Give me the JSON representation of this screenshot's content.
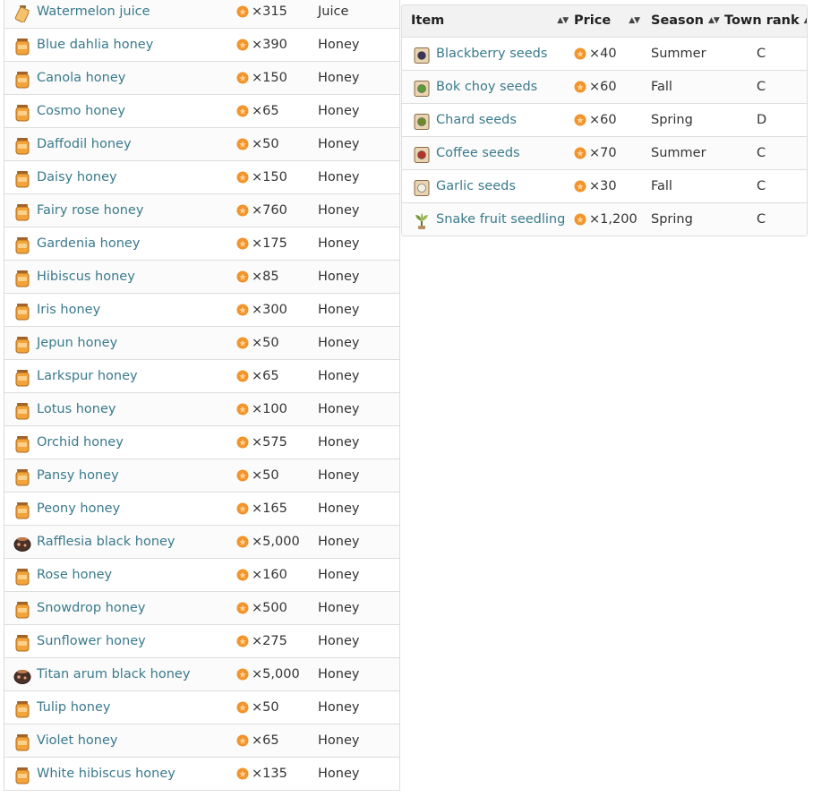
{
  "left_table": {
    "rows": [
      {
        "item": "Watermelon juice",
        "price": "315",
        "type": "Juice",
        "icon": "juice-bottle-icon"
      },
      {
        "item": "Blue dahlia honey",
        "price": "390",
        "type": "Honey",
        "icon": "honey-jar-icon"
      },
      {
        "item": "Canola honey",
        "price": "150",
        "type": "Honey",
        "icon": "honey-jar-icon"
      },
      {
        "item": "Cosmo honey",
        "price": "65",
        "type": "Honey",
        "icon": "honey-jar-icon"
      },
      {
        "item": "Daffodil honey",
        "price": "50",
        "type": "Honey",
        "icon": "honey-jar-icon"
      },
      {
        "item": "Daisy honey",
        "price": "150",
        "type": "Honey",
        "icon": "honey-jar-icon"
      },
      {
        "item": "Fairy rose honey",
        "price": "760",
        "type": "Honey",
        "icon": "honey-jar-icon"
      },
      {
        "item": "Gardenia honey",
        "price": "175",
        "type": "Honey",
        "icon": "honey-jar-icon"
      },
      {
        "item": "Hibiscus honey",
        "price": "85",
        "type": "Honey",
        "icon": "honey-jar-icon"
      },
      {
        "item": "Iris honey",
        "price": "300",
        "type": "Honey",
        "icon": "honey-jar-icon"
      },
      {
        "item": "Jepun honey",
        "price": "50",
        "type": "Honey",
        "icon": "honey-jar-icon"
      },
      {
        "item": "Larkspur honey",
        "price": "65",
        "type": "Honey",
        "icon": "honey-jar-icon"
      },
      {
        "item": "Lotus honey",
        "price": "100",
        "type": "Honey",
        "icon": "honey-jar-icon"
      },
      {
        "item": "Orchid honey",
        "price": "575",
        "type": "Honey",
        "icon": "honey-jar-icon"
      },
      {
        "item": "Pansy honey",
        "price": "50",
        "type": "Honey",
        "icon": "honey-jar-icon"
      },
      {
        "item": "Peony honey",
        "price": "165",
        "type": "Honey",
        "icon": "honey-jar-icon"
      },
      {
        "item": "Rafflesia black honey",
        "price": "5,000",
        "type": "Honey",
        "icon": "black-honey-icon"
      },
      {
        "item": "Rose honey",
        "price": "160",
        "type": "Honey",
        "icon": "honey-jar-icon"
      },
      {
        "item": "Snowdrop honey",
        "price": "500",
        "type": "Honey",
        "icon": "honey-jar-icon"
      },
      {
        "item": "Sunflower honey",
        "price": "275",
        "type": "Honey",
        "icon": "honey-jar-icon"
      },
      {
        "item": "Titan arum black honey",
        "price": "5,000",
        "type": "Honey",
        "icon": "black-honey-icon"
      },
      {
        "item": "Tulip honey",
        "price": "50",
        "type": "Honey",
        "icon": "honey-jar-icon"
      },
      {
        "item": "Violet honey",
        "price": "65",
        "type": "Honey",
        "icon": "honey-jar-icon"
      },
      {
        "item": "White hibiscus honey",
        "price": "135",
        "type": "Honey",
        "icon": "honey-jar-icon"
      }
    ]
  },
  "right_table": {
    "headers": {
      "item": "Item",
      "price": "Price",
      "season": "Season",
      "rank": "Town rank",
      "sort_glyph": "▲▼"
    },
    "rows": [
      {
        "item": "Blackberry seeds",
        "price": "40",
        "season": "Summer",
        "rank": "C",
        "icon": "seed-packet-icon",
        "accent": "#3b3658"
      },
      {
        "item": "Bok choy seeds",
        "price": "60",
        "season": "Fall",
        "rank": "C",
        "icon": "seed-packet-icon",
        "accent": "#5c9a3a"
      },
      {
        "item": "Chard seeds",
        "price": "60",
        "season": "Spring",
        "rank": "D",
        "icon": "seed-packet-icon",
        "accent": "#6e8a2e"
      },
      {
        "item": "Coffee seeds",
        "price": "70",
        "season": "Summer",
        "rank": "C",
        "icon": "seed-packet-icon",
        "accent": "#b2342a"
      },
      {
        "item": "Garlic seeds",
        "price": "30",
        "season": "Fall",
        "rank": "C",
        "icon": "seed-packet-icon",
        "accent": "#f2efe6"
      },
      {
        "item": "Snake fruit seedling",
        "price": "1,200",
        "season": "Spring",
        "rank": "C",
        "icon": "seedling-icon",
        "accent": "#7a9a3a"
      }
    ]
  },
  "currency": {
    "icon": "coin-icon",
    "times": "×",
    "color": "#f2942a"
  },
  "colors": {
    "link": "#3a7a8c",
    "border": "#dddddd",
    "header_bg": "#f2f2f2"
  }
}
